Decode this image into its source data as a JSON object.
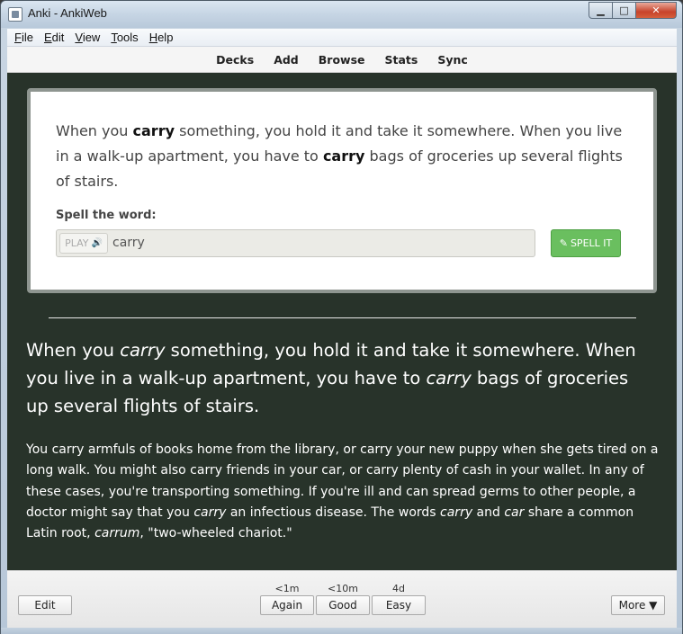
{
  "window": {
    "title": "Anki - AnkiWeb",
    "minimize": "▁",
    "maximize": "□",
    "close": "✕"
  },
  "menu": [
    {
      "acc": "F",
      "rest": "ile"
    },
    {
      "acc": "E",
      "rest": "dit"
    },
    {
      "acc": "V",
      "rest": "iew"
    },
    {
      "acc": "T",
      "rest": "ools"
    },
    {
      "acc": "H",
      "rest": "elp"
    }
  ],
  "toolbar": [
    "Decks",
    "Add",
    "Browse",
    "Stats",
    "Sync"
  ],
  "card": {
    "sentence_parts": [
      {
        "t": "When you ",
        "b": false
      },
      {
        "t": "carry",
        "b": true
      },
      {
        "t": " something, you hold it and take it somewhere. When you live in a walk-up apartment, you have to ",
        "b": false
      },
      {
        "t": "carry",
        "b": true
      },
      {
        "t": " bags of groceries up several flights of stairs.",
        "b": false
      }
    ],
    "spell_label": "Spell the word:",
    "play_label": "PLAY",
    "input_value": "carry",
    "spell_button": "SPELL IT"
  },
  "answer": {
    "sentence_parts": [
      {
        "t": "When you ",
        "i": false
      },
      {
        "t": "carry",
        "i": true
      },
      {
        "t": " something, you hold it and take it somewhere. When you live in a walk-up apartment, you have to ",
        "i": false
      },
      {
        "t": "carry",
        "i": true
      },
      {
        "t": " bags of groceries up several flights of stairs.",
        "i": false
      }
    ],
    "body_parts": [
      {
        "t": "You carry armfuls of books home from the library, or carry your new puppy when she gets tired on a long walk. You might also carry friends in your car, or carry plenty of cash in your wallet. In any of these cases, you're transporting something. If you're ill and can spread germs to other people, a doctor might say that you ",
        "i": false
      },
      {
        "t": "carry",
        "i": true
      },
      {
        "t": " an infectious disease. The words ",
        "i": false
      },
      {
        "t": "carry",
        "i": true
      },
      {
        "t": " and ",
        "i": false
      },
      {
        "t": "car",
        "i": true
      },
      {
        "t": " share a common Latin root, ",
        "i": false
      },
      {
        "t": "carrum",
        "i": true
      },
      {
        "t": ", \"two-wheeled chariot.\"",
        "i": false
      }
    ]
  },
  "review": {
    "edit": "Edit",
    "again": {
      "label": "Again",
      "interval": "<1m"
    },
    "good": {
      "label": "Good",
      "interval": "<10m"
    },
    "easy": {
      "label": "Easy",
      "interval": "4d"
    },
    "more": "More ▼"
  },
  "colors": {
    "background": "#28332a",
    "spell_button": "#6abf5f",
    "card": "#ffffff"
  },
  "icons": {
    "play": "speaker-icon",
    "spell": "pencil-icon"
  }
}
